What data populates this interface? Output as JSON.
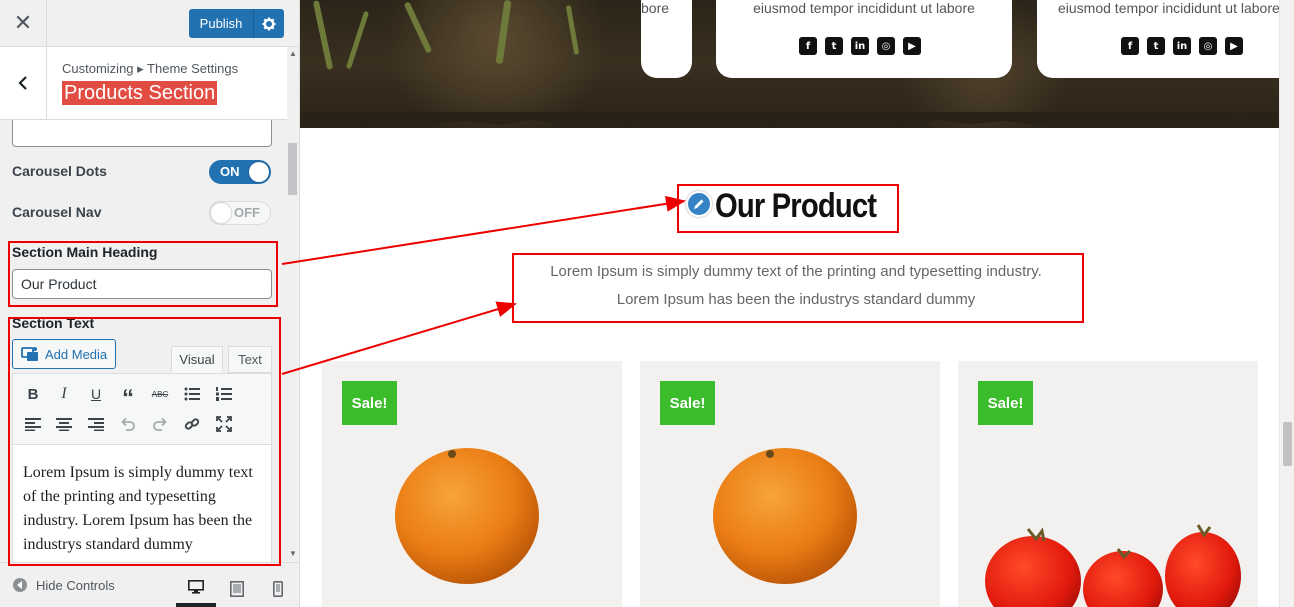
{
  "sidebar": {
    "close_symbol": "✕",
    "publish_label": "Publish",
    "breadcrumb": "Customizing ▸ Theme Settings",
    "section_title": "Products Section",
    "carousel_dots_label": "Carousel Dots",
    "carousel_dots_state": "ON",
    "carousel_nav_label": "Carousel Nav",
    "carousel_nav_state": "OFF",
    "main_heading_label": "Section Main Heading",
    "main_heading_value": "Our Product",
    "section_text_label": "Section Text",
    "add_media_label": "Add Media",
    "tab_visual": "Visual",
    "tab_text": "Text",
    "toolbar_icons": [
      "bold-icon",
      "italic-icon",
      "underline-icon",
      "blockquote-icon",
      "strikethrough-icon",
      "bullet-list-icon",
      "numbered-list-icon",
      "align-left-icon",
      "align-center-icon",
      "align-right-icon",
      "undo-icon",
      "redo-icon",
      "link-icon",
      "fullscreen-icon"
    ],
    "editor_content": "Lorem Ipsum is simply dummy text of the printing and typesetting industry. Lorem Ipsum has been the industrys standard dummy",
    "hide_controls_label": "Hide Controls",
    "devices": [
      "desktop-icon",
      "tablet-icon",
      "mobile-icon"
    ]
  },
  "preview": {
    "team_cards": [
      {
        "text": "bore"
      },
      {
        "text": "eiusmod tempor incididunt ut labore"
      },
      {
        "text": "eiusmod tempor incididunt ut labore"
      }
    ],
    "social_icons": [
      "f",
      "t",
      "in",
      "◎",
      "▶"
    ],
    "heading": "Our Product",
    "intro_line1": "Lorem Ipsum is simply dummy text of the printing and typesetting industry.",
    "intro_line2": "Lorem Ipsum has been the industrys standard dummy",
    "products": [
      {
        "badge": "Sale!",
        "image": "orange"
      },
      {
        "badge": "Sale!",
        "image": "orange"
      },
      {
        "badge": "Sale!",
        "image": "tomatoes"
      }
    ]
  },
  "colors": {
    "accent_blue": "#2271b1",
    "highlight_red": "#e00000",
    "sale_green": "#3bbd2b",
    "title_highlight": "#e14d43"
  }
}
